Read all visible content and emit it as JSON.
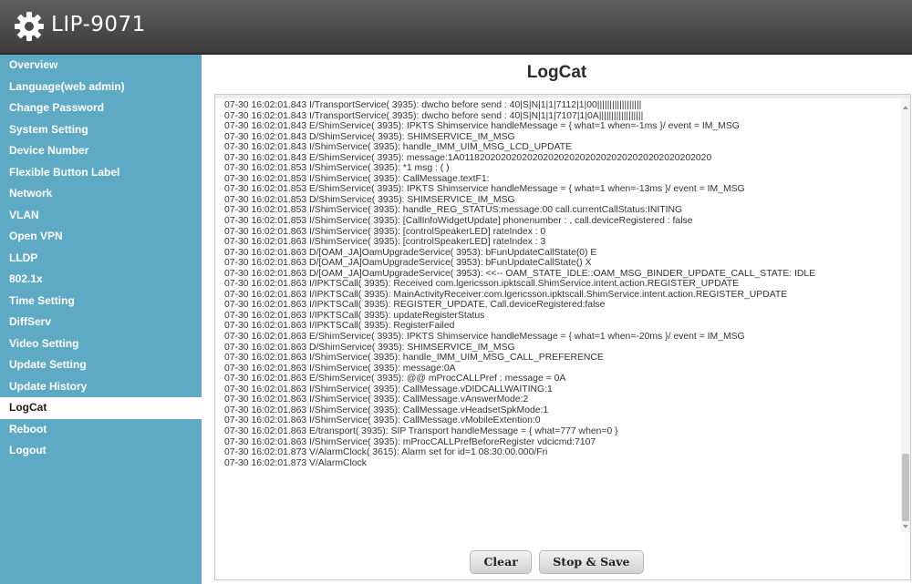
{
  "header": {
    "title": "LIP-9071",
    "logo_icon": "gear-icon"
  },
  "colors": {
    "sidebar_bg": "#5ea9c4",
    "topbar_bg": "#4a4a4a",
    "active_item_bg": "#ffffff"
  },
  "sidebar": {
    "items": [
      {
        "label": "Overview"
      },
      {
        "label": "Language(web admin)"
      },
      {
        "label": "Change Password"
      },
      {
        "label": "System Setting"
      },
      {
        "label": "Device Number"
      },
      {
        "label": "Flexible Button Label"
      },
      {
        "label": "Network"
      },
      {
        "label": "VLAN"
      },
      {
        "label": "Open VPN"
      },
      {
        "label": "LLDP"
      },
      {
        "label": "802.1x"
      },
      {
        "label": "Time Setting"
      },
      {
        "label": "DiffServ"
      },
      {
        "label": "Video Setting"
      },
      {
        "label": "Update Setting"
      },
      {
        "label": "Update History"
      },
      {
        "label": "LogCat",
        "active": true
      },
      {
        "label": "Reboot"
      },
      {
        "label": "Logout"
      }
    ]
  },
  "main": {
    "title": "LogCat",
    "log_lines": [
      "07-30 16:02:01.843 I/TransportService( 3935): dwcho before send : 40|S|N|1|1|7112|1|00||||||||||||||||||",
      "07-30 16:02:01.843 I/TransportService( 3935): dwcho before send : 40|S|N|1|1|7107|1|0A||||||||||||||||||",
      "07-30 16:02:01.843 E/ShimService( 3935): IPKTS Shimservice handleMessage = { what=1 when=-1ms }/ event = IM_MSG",
      "07-30 16:02:01.843 D/ShimService( 3935): SHIMSERVICE_IM_MSG",
      "07-30 16:02:01.843 I/ShimService( 3935): handle_IMM_UIM_MSG_LCD_UPDATE",
      "07-30 16:02:01.843 E/ShimService( 3935): message:1A011820202020202020202020202020202020202020202020",
      "07-30 16:02:01.853 I/ShimService( 3935): *1 msg  :  (                    )",
      "07-30 16:02:01.853 I/ShimService( 3935): CallMessage.textF1:",
      "07-30 16:02:01.853 E/ShimService( 3935): IPKTS Shimservice handleMessage = { what=1 when=-13ms }/ event = IM_MSG",
      "07-30 16:02:01.853 D/ShimService( 3935): SHIMSERVICE_IM_MSG",
      "07-30 16:02:01.853 I/ShimService( 3935): handle_REG_STATUS:message:00 call.currentCallStatus:INITING",
      "07-30 16:02:01.853 I/ShimService( 3935): [CallInfoWidgetUpdate] phonenumber : , call.deviceRegistered : false",
      "07-30 16:02:01.863 I/ShimService( 3935): [controlSpeakerLED] rateIndex : 0",
      "07-30 16:02:01.863 I/ShimService( 3935): [controlSpeakerLED] rateIndex : 3",
      "07-30 16:02:01.863 D/[OAM_JA]OamUpgradeService( 3953): bFunUpdateCallState(0) E",
      "07-30 16:02:01.863 D/[OAM_JA]OamUpgradeService( 3953): bFunUpdateCallState() X",
      "07-30 16:02:01.863 D/[OAM_JA]OamUpgradeService( 3953): <<-- OAM_STATE_IDLE::OAM_MSG_BINDER_UPDATE_CALL_STATE: IDLE",
      "07-30 16:02:01.863 I/IPKTSCall( 3935): Received com.lgericsson.ipktscall.ShimService.intent.action.REGISTER_UPDATE",
      "07-30 16:02:01.863 I/IPKTSCall( 3935): MainActivityReceiver:com.lgericsson.ipktscall.ShimService.intent.action.REGISTER_UPDATE",
      "07-30 16:02:01.863 I/IPKTSCall( 3935): REGISTER_UPDATE, Call.deviceRegistered:false",
      "07-30 16:02:01.863 I/IPKTSCall( 3935): updateRegisterStatus",
      "07-30 16:02:01.863 I/IPKTSCall( 3935): RegisterFailed",
      "07-30 16:02:01.863 E/ShimService( 3935): IPKTS Shimservice handleMessage = { what=1 when=-20ms }/ event = IM_MSG",
      "07-30 16:02:01.863 D/ShimService( 3935): SHIMSERVICE_IM_MSG",
      "07-30 16:02:01.863 I/ShimService( 3935): handle_IMM_UIM_MSG_CALL_PREFERENCE",
      "07-30 16:02:01.863 I/ShimService( 3935): message:0A",
      "07-30 16:02:01.863 E/ShimService( 3935): @@ mProcCALLPref : message = 0A",
      "07-30 16:02:01.863 I/ShimService( 3935): CallMessage.vDIDCALLWAITING:1",
      "07-30 16:02:01.863 I/ShimService( 3935): CallMessage.vAnswerMode:2",
      "07-30 16:02:01.863 I/ShimService( 3935): CallMessage.vHeadsetSpkMode:1",
      "07-30 16:02:01.863 I/ShimService( 3935): CallMessage.vMobileExtention:0",
      "07-30 16:02:01.863 E/transport( 3935): SIP Transport handleMessage = { what=777 when=0 }",
      "07-30 16:02:01.863 I/ShimService( 3935): mProcCALLPrefBeforeRegister vdcicmd:7107",
      "07-30 16:02:01.873 V/AlarmClock( 3615): Alarm set for id=1 08:30:00.000/Fri",
      "07-30 16:02:01.873 V/AlarmClock"
    ],
    "buttons": {
      "clear": "Clear",
      "stop_save": "Stop & Save"
    }
  }
}
